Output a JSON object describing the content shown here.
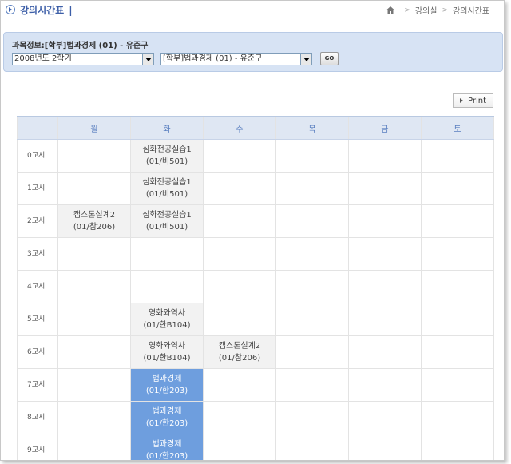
{
  "header": {
    "title": "강의시간표",
    "separator": "|",
    "breadcrumb": [
      "강의실",
      "강의시간표"
    ]
  },
  "course_info": {
    "label": "과목정보:[학부]법과경제 (01) - 유준구",
    "semester_select": "2008년도 2학기",
    "course_select": "[학부]법과경제 (01) - 유준구",
    "go_label": "GO"
  },
  "print_label": "Print",
  "timetable": {
    "days": [
      "월",
      "화",
      "수",
      "목",
      "금",
      "토"
    ],
    "rows": [
      {
        "period": "0교시",
        "cells": [
          null,
          {
            "name": "심화전공실습1",
            "room": "(01/비501)",
            "style": "filled"
          },
          null,
          null,
          null,
          null
        ]
      },
      {
        "period": "1교시",
        "cells": [
          null,
          {
            "name": "심화전공실습1",
            "room": "(01/비501)",
            "style": "filled"
          },
          null,
          null,
          null,
          null
        ]
      },
      {
        "period": "2교시",
        "cells": [
          {
            "name": "캡스톤설계2",
            "room": "(01/참206)",
            "style": "filled"
          },
          {
            "name": "심화전공실습1",
            "room": "(01/비501)",
            "style": "filled"
          },
          null,
          null,
          null,
          null
        ]
      },
      {
        "period": "3교시",
        "cells": [
          null,
          null,
          null,
          null,
          null,
          null
        ]
      },
      {
        "period": "4교시",
        "cells": [
          null,
          null,
          null,
          null,
          null,
          null
        ]
      },
      {
        "period": "5교시",
        "cells": [
          null,
          {
            "name": "영화와역사",
            "room": "(01/한B104)",
            "style": "filled"
          },
          null,
          null,
          null,
          null
        ]
      },
      {
        "period": "6교시",
        "cells": [
          null,
          {
            "name": "영화와역사",
            "room": "(01/한B104)",
            "style": "filled"
          },
          {
            "name": "캡스톤설계2",
            "room": "(01/참206)",
            "style": "filled"
          },
          null,
          null,
          null
        ]
      },
      {
        "period": "7교시",
        "cells": [
          null,
          {
            "name": "법과경제",
            "room": "(01/한203)",
            "style": "hl"
          },
          null,
          null,
          null,
          null
        ]
      },
      {
        "period": "8교시",
        "cells": [
          null,
          {
            "name": "법과경제",
            "room": "(01/한203)",
            "style": "hl"
          },
          null,
          null,
          null,
          null
        ]
      },
      {
        "period": "9교시",
        "cells": [
          null,
          {
            "name": "법과경제",
            "room": "(01/한203)",
            "style": "hl"
          },
          null,
          null,
          null,
          null
        ]
      }
    ]
  },
  "colors": {
    "accent": "#3d5fa8",
    "info_box_bg": "#d7e3f4",
    "highlight_cell": "#6e9ede",
    "filled_cell": "#f2f2f2"
  }
}
